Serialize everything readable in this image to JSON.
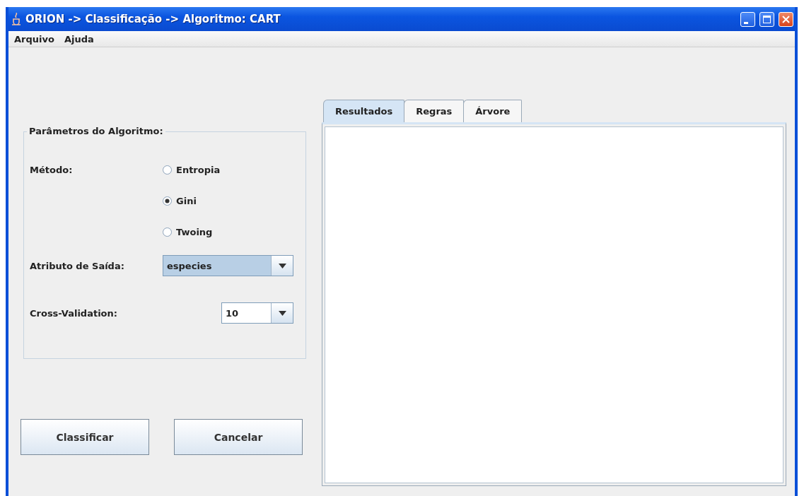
{
  "window": {
    "title": "ORION -> Classificação -> Algoritmo: CART"
  },
  "menu": [
    "Arquivo",
    "Ajuda"
  ],
  "parameters": {
    "title": "Parâmetros do Algoritmo:",
    "method_label": "Método:",
    "methods": [
      {
        "label": "Entropia",
        "selected": false
      },
      {
        "label": "Gini",
        "selected": true
      },
      {
        "label": "Twoing",
        "selected": false
      }
    ],
    "output_attribute": {
      "label": "Atributo de Saída:",
      "value": "especies",
      "focused": true
    },
    "cross_validation": {
      "label": "Cross-Validation:",
      "value": "10",
      "focused": false
    }
  },
  "buttons": [
    "Classificar",
    "Cancelar"
  ],
  "tabs": [
    {
      "label": "Resultados",
      "selected": true
    },
    {
      "label": "Regras",
      "selected": false
    },
    {
      "label": "Árvore",
      "selected": false
    }
  ]
}
